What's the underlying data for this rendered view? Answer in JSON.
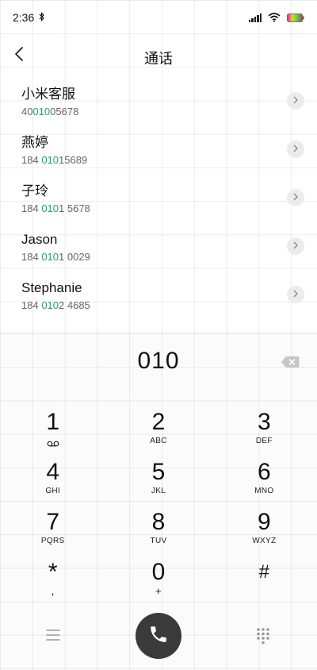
{
  "status_bar": {
    "time": "2:36"
  },
  "header": {
    "title": "通话"
  },
  "contacts": [
    {
      "name": "小米客服",
      "number_prefix": "40",
      "number_match": "010",
      "number_suffix": "05678"
    },
    {
      "name": "燕婷",
      "number_prefix": "184 ",
      "number_match": "010",
      "number_suffix": "15689"
    },
    {
      "name": "子玲",
      "number_prefix": "184 ",
      "number_match": "010",
      "number_suffix": "1 5678"
    },
    {
      "name": "Jason",
      "number_prefix": "184 ",
      "number_match": "010",
      "number_suffix": "1 0029"
    },
    {
      "name": "Stephanie",
      "number_prefix": "184 ",
      "number_match": "010",
      "number_suffix": "2 4685"
    }
  ],
  "dialer": {
    "number": "010",
    "keys": [
      {
        "digit": "1",
        "letters": ""
      },
      {
        "digit": "2",
        "letters": "ABC"
      },
      {
        "digit": "3",
        "letters": "DEF"
      },
      {
        "digit": "4",
        "letters": "GHI"
      },
      {
        "digit": "5",
        "letters": "JKL"
      },
      {
        "digit": "6",
        "letters": "MNO"
      },
      {
        "digit": "7",
        "letters": "PQRS"
      },
      {
        "digit": "8",
        "letters": "TUV"
      },
      {
        "digit": "9",
        "letters": "WXYZ"
      },
      {
        "digit": "*",
        "letters": ","
      },
      {
        "digit": "0",
        "letters": "+"
      },
      {
        "digit": "#",
        "letters": ""
      }
    ]
  },
  "colors": {
    "match_highlight": "#1aa66a",
    "call_button": "#3a3a3a"
  },
  "icons": {
    "back": "chevron-left-icon",
    "detail": "chevron-right-icon",
    "backspace": "backspace-icon",
    "menu": "menu-icon",
    "call": "phone-icon",
    "keypad_toggle": "dialpad-icon",
    "voicemail": "voicemail-icon"
  }
}
